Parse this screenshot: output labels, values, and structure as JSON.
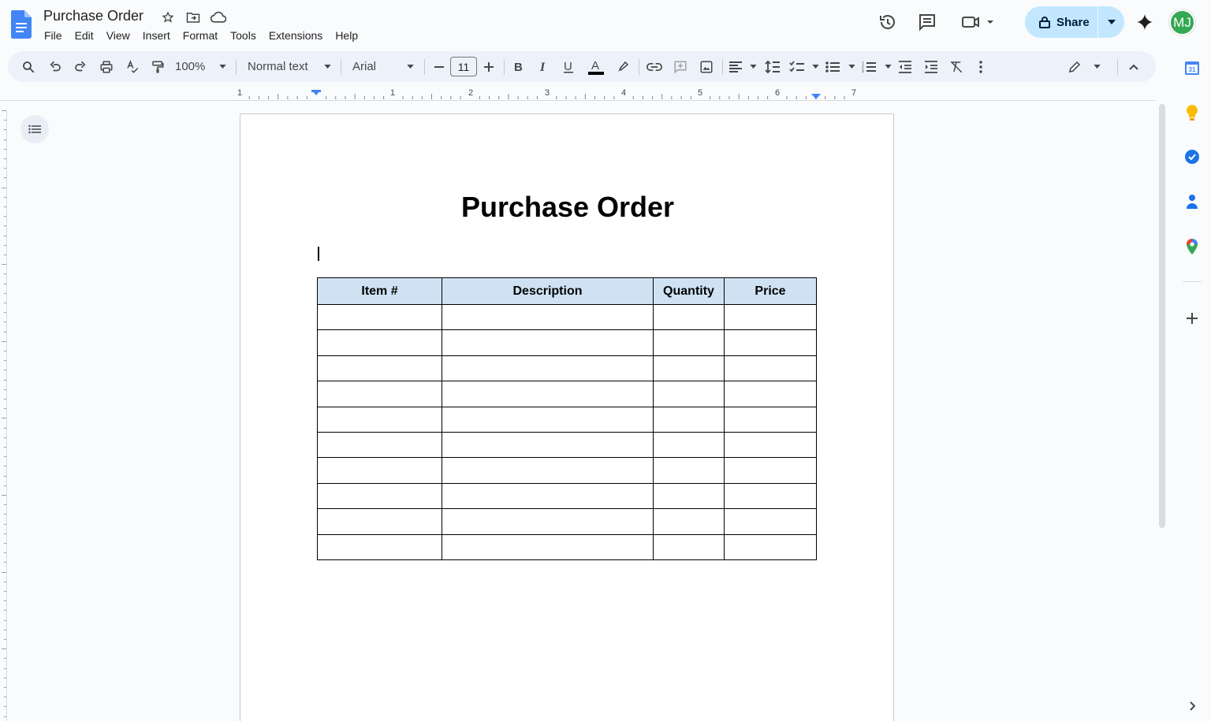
{
  "window": {
    "doc_title": "Purchase Order",
    "menu": [
      "File",
      "Edit",
      "View",
      "Insert",
      "Format",
      "Tools",
      "Extensions",
      "Help"
    ],
    "share_label": "Share",
    "avatar_initials": "MJ"
  },
  "toolbar": {
    "zoom": "100%",
    "style": "Normal text",
    "font": "Arial",
    "font_size": "11"
  },
  "ruler": {
    "labels": [
      "1",
      "1",
      "2",
      "3",
      "4",
      "5",
      "6",
      "7"
    ]
  },
  "document": {
    "heading": "Purchase Order",
    "table": {
      "headers": [
        "Item #",
        "Description",
        "Quantity",
        "Price"
      ],
      "empty_rows": 10
    }
  },
  "colors": {
    "accent": "#0b57d0",
    "share_bg": "#c2e7ff",
    "table_header_bg": "#cfe2f3",
    "toolbar_bg": "#edf2fa",
    "avatar_bg": "#34a853"
  },
  "icons": {
    "sidebar": [
      "calendar-icon",
      "keep-icon",
      "tasks-icon",
      "contacts-icon",
      "maps-icon",
      "add-icon"
    ]
  }
}
